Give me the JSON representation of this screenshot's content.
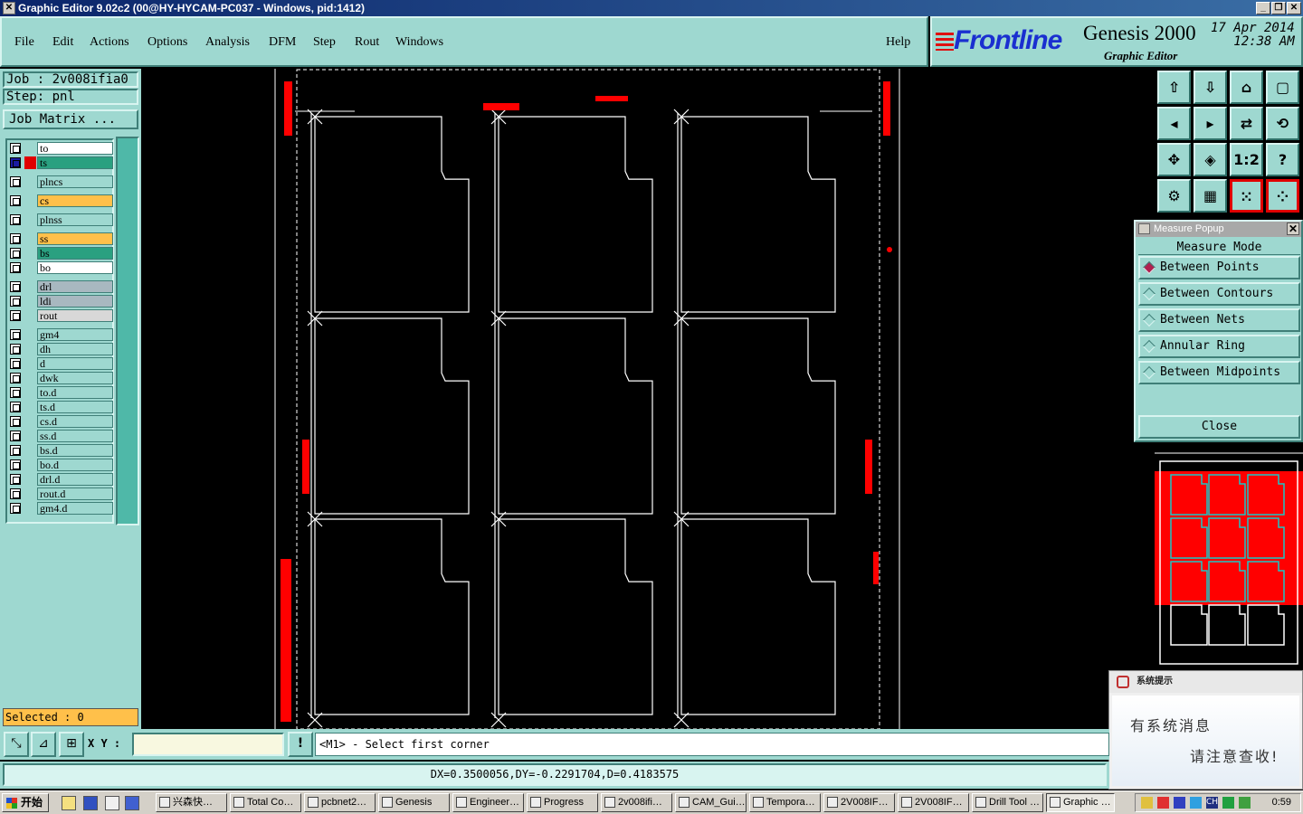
{
  "window": {
    "title": "Graphic Editor 9.02c2 (00@HY-HYCAM-PC037 - Windows, pid:1412)",
    "controls": [
      "_",
      "❐",
      "✕"
    ]
  },
  "menu": {
    "items": [
      "File",
      "Edit",
      "Actions",
      "Options",
      "Analysis",
      "DFM",
      "Step",
      "Rout",
      "Windows"
    ],
    "help": "Help"
  },
  "brand": {
    "logo": "Frontline",
    "product": "Genesis 2000",
    "subtitle": "Graphic Editor",
    "date": "17 Apr 2014",
    "time": "12:38 AM"
  },
  "job": {
    "job_label": "Job : 2v008ifia0",
    "step_label": "Step: pnl",
    "matrix_button": "Job Matrix ..."
  },
  "layers": [
    {
      "name": "to",
      "color": "#ffffff"
    },
    {
      "name": "ts",
      "color": "#2aa080",
      "active": true
    },
    {
      "name": "plncs",
      "color": "#9ed8d0"
    },
    {
      "name": "cs",
      "color": "#ffc04a"
    },
    {
      "name": "plnss",
      "color": "#9ed8d0"
    },
    {
      "name": "ss",
      "color": "#ffc04a"
    },
    {
      "name": "bs",
      "color": "#2aa080"
    },
    {
      "name": "bo",
      "color": "#ffffff"
    },
    {
      "name": "drl",
      "color": "#a8b8c0"
    },
    {
      "name": "ldi",
      "color": "#a8b8c0"
    },
    {
      "name": "rout",
      "color": "#d8d8d8"
    },
    {
      "name": "gm4",
      "color": "#9ed8d0"
    },
    {
      "name": "dh",
      "color": "#9ed8d0"
    },
    {
      "name": "d",
      "color": "#9ed8d0"
    },
    {
      "name": "dwk",
      "color": "#9ed8d0"
    },
    {
      "name": "to.d",
      "color": "#9ed8d0"
    },
    {
      "name": "ts.d",
      "color": "#9ed8d0"
    },
    {
      "name": "cs.d",
      "color": "#9ed8d0"
    },
    {
      "name": "ss.d",
      "color": "#9ed8d0"
    },
    {
      "name": "bs.d",
      "color": "#9ed8d0"
    },
    {
      "name": "bo.d",
      "color": "#9ed8d0"
    },
    {
      "name": "drl.d",
      "color": "#9ed8d0"
    },
    {
      "name": "rout.d",
      "color": "#9ed8d0"
    },
    {
      "name": "gm4.d",
      "color": "#9ed8d0"
    }
  ],
  "selected_label": "Selected : 0",
  "measure_popup": {
    "title": "Measure Popup",
    "mode_header": "Measure Mode",
    "options": [
      "Between Points",
      "Between Contours",
      "Between Nets",
      "Annular Ring",
      "Between Midpoints"
    ],
    "selected_option": "Between Points",
    "close": "Close"
  },
  "toolbar_icons": [
    "panel-up-icon",
    "panel-down-icon",
    "home-icon",
    "window-icon",
    "move-left-icon",
    "move-right-icon",
    "swap-icon",
    "route-icon",
    "fit-all-icon",
    "fit-center-icon",
    "one-to-one-icon",
    "help-icon",
    "tools-icon",
    "grid-icon",
    "layer-toggle-icon",
    "layer-toggle-alt-icon"
  ],
  "toolbar_glyphs": [
    "⇧",
    "⇩",
    "⌂",
    "▢",
    "◂",
    "▸",
    "⇄",
    "⟲",
    "✥",
    "◈",
    "1:2",
    "?",
    "⚙",
    "▦",
    "⁙",
    "⁘"
  ],
  "command": {
    "xy_label": "X Y :",
    "xy_value": "",
    "excl": "!",
    "prompt": "<M1> - Select first corner"
  },
  "status": "DX=0.3500056,DY=-0.2291704,D=0.4183575",
  "notification": {
    "title": "系统提示",
    "line1": "有系统消息",
    "line2": "请注意查收!"
  },
  "taskbar": {
    "start": "开始",
    "tasks": [
      "兴森快…",
      "Total Co…",
      "pcbnet2…",
      "Genesis",
      "Engineer…",
      "Progress",
      "2v008ifi…",
      "CAM_Gui…",
      "Tempora…",
      "2V008IF…",
      "2V008IF…",
      "Drill Tool …",
      "Graphic …"
    ],
    "active_task": "Graphic …",
    "clock": "0:59"
  },
  "colors": {
    "panel": "#9ed8d0",
    "outline": "#ffffff",
    "marker": "#ff0000",
    "overview_border": "#19c8c8"
  }
}
